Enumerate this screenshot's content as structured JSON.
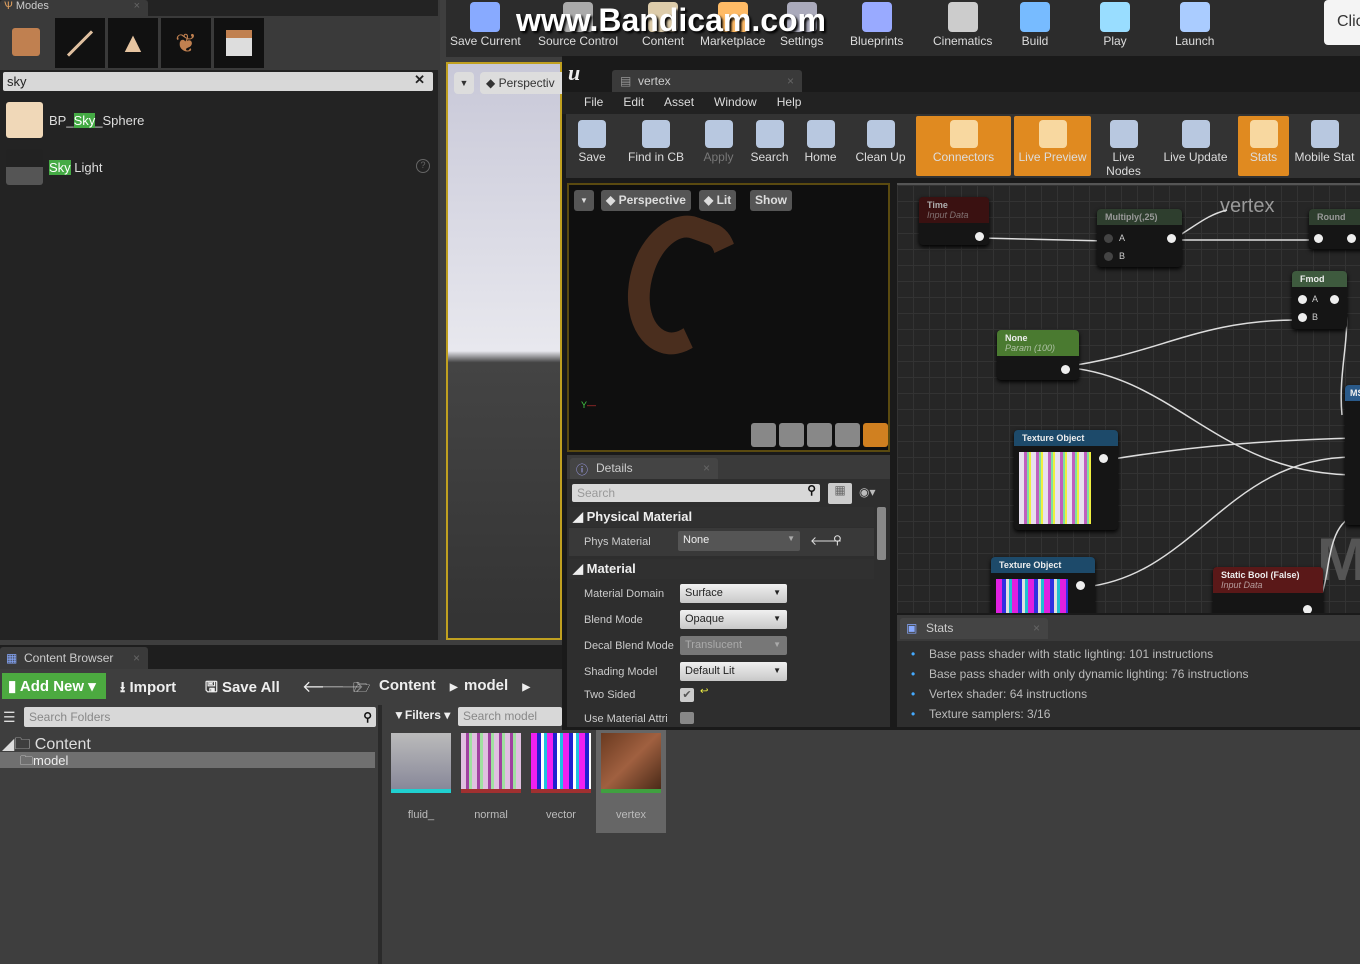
{
  "modes": {
    "tab": "Modes",
    "search_value": "sky",
    "results": [
      {
        "pre": "BP_",
        "hit": "Sky",
        "post": "_Sphere"
      },
      {
        "pre": "",
        "hit": "Sky",
        "post": " Light"
      }
    ]
  },
  "main_toolbar": [
    "Save Current",
    "Source Control",
    "Content",
    "Marketplace",
    "Settings",
    "Blueprints",
    "Cinematics",
    "Build",
    "Play",
    "Launch"
  ],
  "watermark": "www.Bandicam.com",
  "corner_button": "Clic",
  "level_viewport": {
    "view": "Perspectiv"
  },
  "material_editor": {
    "tab": "vertex",
    "menu": [
      "File",
      "Edit",
      "Asset",
      "Window",
      "Help"
    ],
    "toolbar": [
      {
        "label": "Save",
        "active": false
      },
      {
        "label": "Find in CB",
        "active": false
      },
      {
        "label": "Apply",
        "active": false
      },
      {
        "label": "Search",
        "active": false
      },
      {
        "label": "Home",
        "active": false
      },
      {
        "label": "Clean Up",
        "active": false
      },
      {
        "label": "Connectors",
        "active": true
      },
      {
        "label": "Live Preview",
        "active": true
      },
      {
        "label": "Live Nodes",
        "active": false
      },
      {
        "label": "Live Update",
        "active": false
      },
      {
        "label": "Stats",
        "active": true
      },
      {
        "label": "Mobile Stat",
        "active": false
      }
    ],
    "viewport": {
      "perspective": "Perspective",
      "lit": "Lit",
      "show": "Show"
    },
    "details": {
      "tab": "Details",
      "search_placeholder": "Search",
      "physical": {
        "title": "Physical Material",
        "label": "Phys Material",
        "value": "None"
      },
      "material": {
        "title": "Material",
        "rows": [
          {
            "label": "Material Domain",
            "value": "Surface"
          },
          {
            "label": "Blend Mode",
            "value": "Opaque"
          },
          {
            "label": "Decal Blend Mode",
            "value": "Translucent"
          },
          {
            "label": "Shading Model",
            "value": "Default Lit"
          }
        ],
        "two_sided": "Two Sided",
        "two_sided_checked": true,
        "use_attr": "Use Material Attri"
      }
    },
    "graph": {
      "title": "vertex",
      "watermark": "M",
      "nodes": {
        "time": {
          "title": "Time",
          "sub": "Input Data"
        },
        "multiply": {
          "title": "Multiply(,25)",
          "a": "A",
          "b": "B"
        },
        "round": {
          "title": "Round"
        },
        "fmod": {
          "title": "Fmod",
          "a": "A",
          "b": "B"
        },
        "none": {
          "title": "None",
          "sub": "Param (100)"
        },
        "tex1": {
          "title": "Texture Object"
        },
        "tex2": {
          "title": "Texture Object"
        },
        "bool": {
          "title": "Static Bool (False)",
          "sub": "Input Data"
        },
        "ms": {
          "title": "MS"
        }
      }
    },
    "stats": {
      "tab": "Stats",
      "lines": [
        "Base pass shader with static lighting: 101 instructions",
        "Base pass shader with only dynamic lighting: 76 instructions",
        "Vertex shader: 64 instructions",
        "Texture samplers: 3/16"
      ]
    }
  },
  "content_browser": {
    "tab": "Content Browser",
    "add_new": "Add New",
    "import": "Import",
    "save_all": "Save All",
    "path": [
      "Content",
      "model"
    ],
    "search_folders": "Search Folders",
    "filters": "Filters",
    "search_assets": "Search model",
    "tree": {
      "root": "Content",
      "child": "model"
    },
    "assets": [
      {
        "name": "fluid_",
        "bar": "#20d0d0"
      },
      {
        "name": "normal",
        "bar": "#a03030"
      },
      {
        "name": "vector",
        "bar": "#a03030"
      },
      {
        "name": "vertex",
        "bar": "#40a040"
      }
    ]
  }
}
